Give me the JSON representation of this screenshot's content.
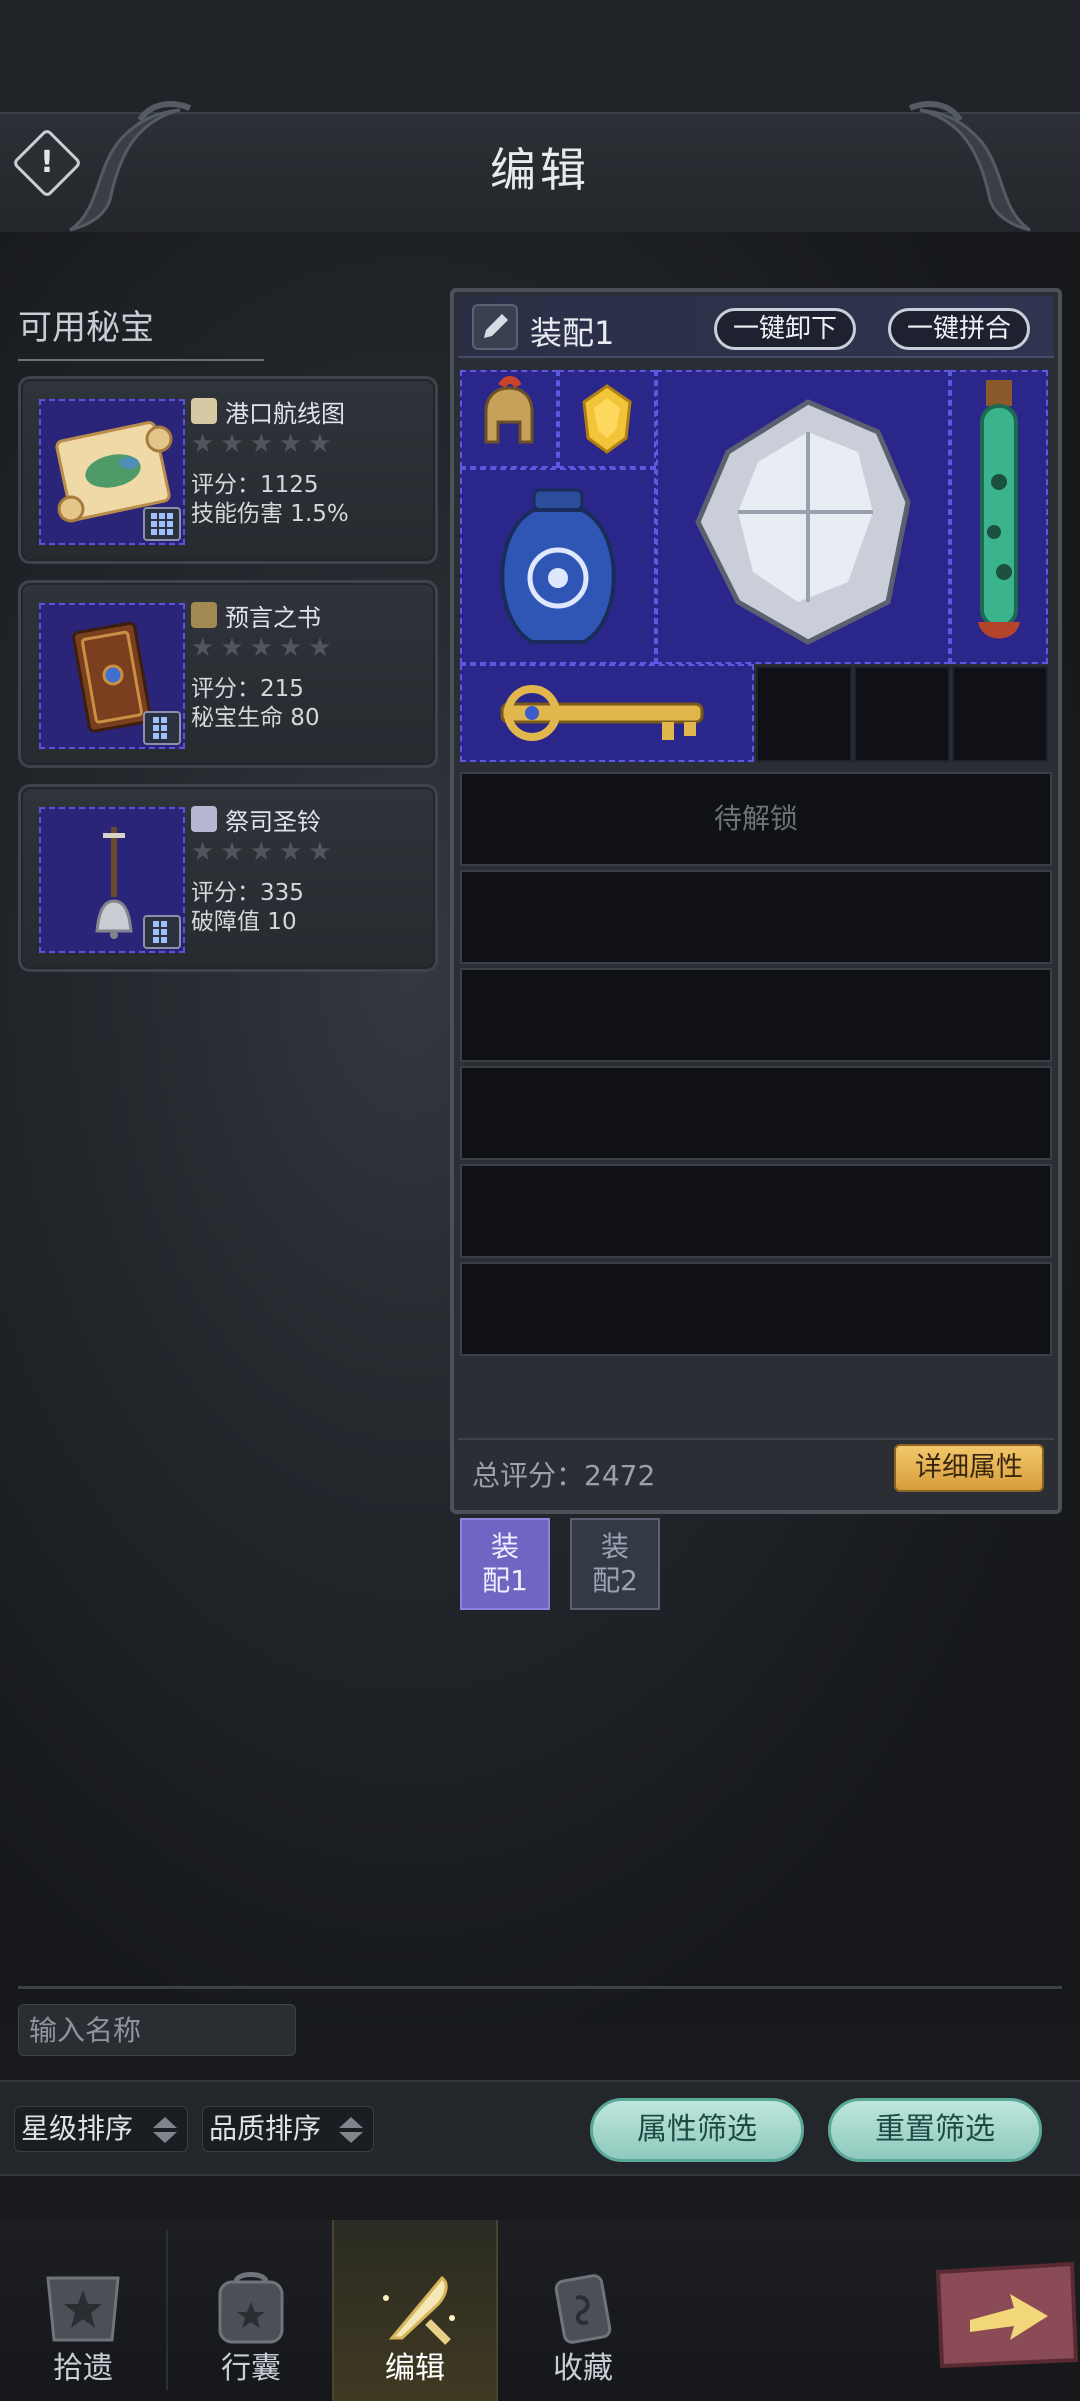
{
  "header": {
    "title": "编辑",
    "info_icon": "!"
  },
  "left": {
    "section_title": "可用秘宝",
    "relics": [
      {
        "name": "港口航线图",
        "stars_filled": 0,
        "stars_total": 5,
        "score": "评分：1125",
        "effect": "技能伤害 1.5%",
        "icon": "map-scroll-icon"
      },
      {
        "name": "预言之书",
        "stars_filled": 0,
        "stars_total": 5,
        "score": "评分：215",
        "effect": "秘宝生命 80",
        "icon": "tome-icon"
      },
      {
        "name": "祭司圣铃",
        "stars_filled": 0,
        "stars_total": 5,
        "score": "评分：335",
        "effect": "破障值 10",
        "icon": "bell-icon"
      }
    ]
  },
  "panel": {
    "loadout_name": "装配1",
    "unload_all": "一键卸下",
    "auto_merge": "一键拼合",
    "locked_label": "待解锁",
    "total_score": "总评分：2472",
    "detail_button": "详细属性",
    "equipped_icons": [
      "helmet-icon",
      "gold-gem-icon",
      "silver-ore-icon",
      "potion-tube-icon",
      "blue-vase-icon",
      "golden-key-icon"
    ]
  },
  "loadout_tabs": [
    {
      "line1": "装",
      "line2": "配1",
      "active": true
    },
    {
      "line1": "装",
      "line2": "配2",
      "active": false
    }
  ],
  "name_input": {
    "placeholder": "输入名称"
  },
  "filters": {
    "star_sort": "星级排序",
    "quality_sort": "品质排序",
    "attr_filter": "属性筛选",
    "reset_filter": "重置筛选"
  },
  "nav": {
    "items": [
      {
        "label": "拾遗",
        "icon": "relic-shrine-icon",
        "active": false
      },
      {
        "label": "行囊",
        "icon": "backpack-icon",
        "active": false
      },
      {
        "label": "编辑",
        "icon": "quill-wrench-icon",
        "active": true
      },
      {
        "label": "收藏",
        "icon": "scroll-collection-icon",
        "active": false
      }
    ],
    "go_icon": "arrow-right-icon"
  },
  "colors": {
    "slot_purple": "#2b278a",
    "accent_gold": "#e5b656",
    "teal": "#a9d9cd",
    "tab_active": "#6f66c4"
  }
}
